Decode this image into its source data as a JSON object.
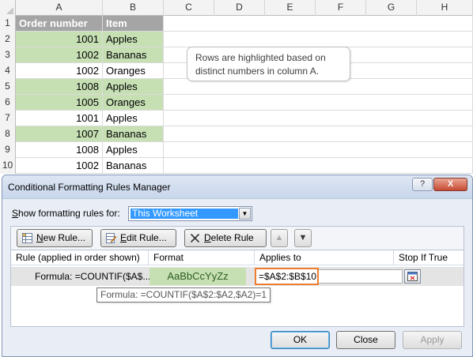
{
  "sheet": {
    "columns": [
      "A",
      "B",
      "C",
      "D",
      "E",
      "F",
      "G",
      "H"
    ],
    "header": {
      "row_num": "1",
      "order": "Order number",
      "item": "Item"
    },
    "rows": [
      {
        "row_num": "2",
        "order": "1001",
        "item": "Apples",
        "highlight": true
      },
      {
        "row_num": "3",
        "order": "1002",
        "item": "Bananas",
        "highlight": true
      },
      {
        "row_num": "4",
        "order": "1002",
        "item": "Oranges",
        "highlight": false
      },
      {
        "row_num": "5",
        "order": "1008",
        "item": "Apples",
        "highlight": true
      },
      {
        "row_num": "6",
        "order": "1005",
        "item": "Oranges",
        "highlight": true
      },
      {
        "row_num": "7",
        "order": "1001",
        "item": "Apples",
        "highlight": false
      },
      {
        "row_num": "8",
        "order": "1007",
        "item": "Bananas",
        "highlight": true
      },
      {
        "row_num": "9",
        "order": "1008",
        "item": "Apples",
        "highlight": false
      },
      {
        "row_num": "10",
        "order": "1002",
        "item": "Bananas",
        "highlight": false
      }
    ],
    "note_line1": "Rows are highlighted based on",
    "note_line2": "distinct numbers in column A.",
    "colors": {
      "highlight": "#c6e0b4",
      "header_bg": "#a5a5a5"
    }
  },
  "dialog": {
    "title": "Conditional Formatting Rules Manager",
    "help_label": "?",
    "close_label": "X",
    "show_label_s": "S",
    "show_label_rest": "how formatting rules for:",
    "show_value": "This Worksheet",
    "toolbar": {
      "new_u": "N",
      "new_rest": "ew Rule...",
      "edit_u": "E",
      "edit_rest": "dit Rule...",
      "delete_u": "D",
      "delete_rest": "elete Rule",
      "up_label": "▲",
      "down_label": "▼"
    },
    "list": {
      "col_rule": "Rule (applied in order shown)",
      "col_format": "Format",
      "col_applies": "Applies to",
      "col_stop": "Stop If True",
      "rule_text": "Formula: =COUNTIF($A$...",
      "format_preview": "AaBbCcYyZz",
      "applies_value": "=$A$2:$B$10",
      "tooltip": "Formula: =COUNTIF($A$2:$A2,$A2)=1"
    },
    "buttons": {
      "ok": "OK",
      "close": "Close",
      "apply": "Apply"
    },
    "colors": {
      "accent": "#ed7d31",
      "selection": "#3399ff"
    }
  }
}
